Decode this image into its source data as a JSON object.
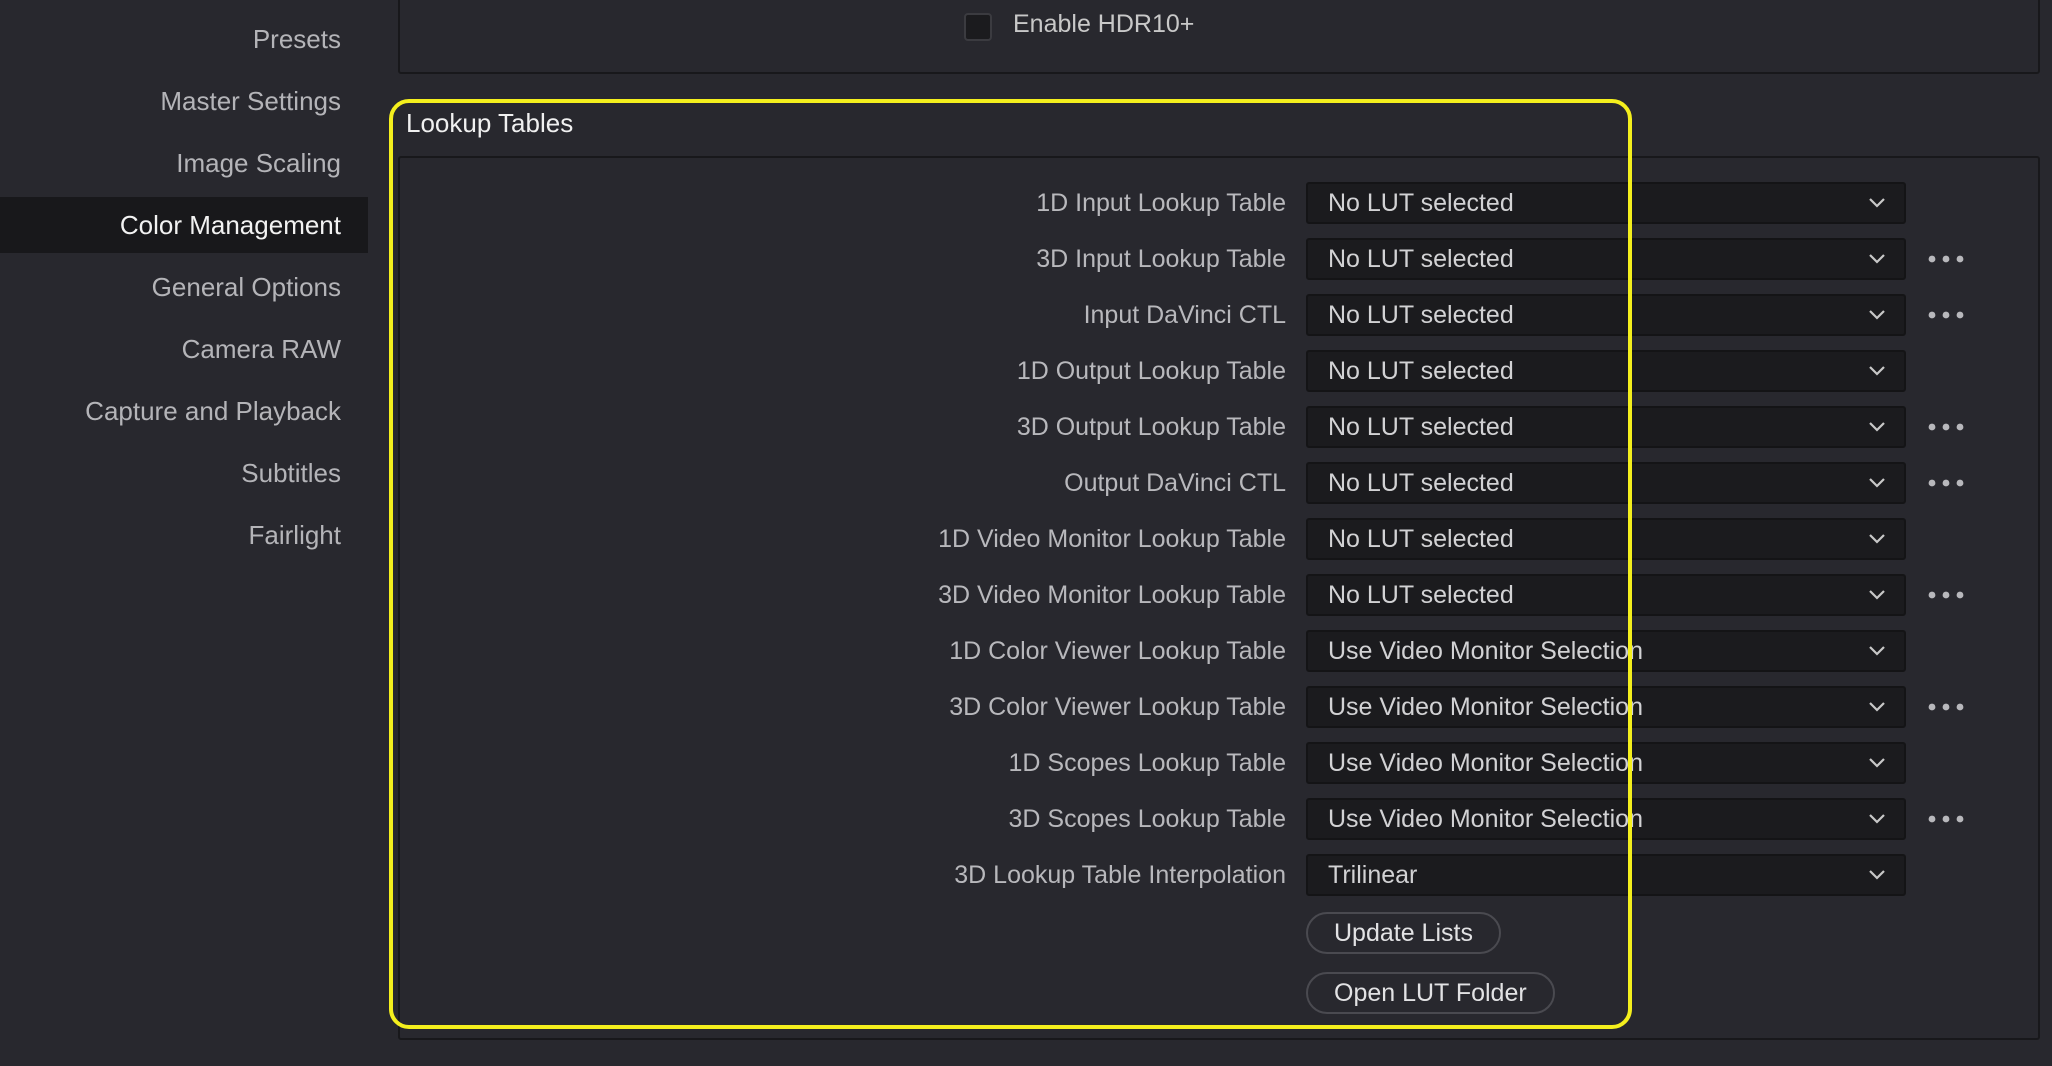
{
  "sidebar": {
    "items": [
      {
        "label": "Presets",
        "active": false
      },
      {
        "label": "Master Settings",
        "active": false
      },
      {
        "label": "Image Scaling",
        "active": false
      },
      {
        "label": "Color Management",
        "active": true
      },
      {
        "label": "General Options",
        "active": false
      },
      {
        "label": "Camera RAW",
        "active": false
      },
      {
        "label": "Capture and Playback",
        "active": false
      },
      {
        "label": "Subtitles",
        "active": false
      },
      {
        "label": "Fairlight",
        "active": false
      }
    ]
  },
  "top_panel": {
    "checkbox_label": "Enable HDR10+",
    "checkbox_checked": false
  },
  "lookup_tables": {
    "title": "Lookup Tables",
    "rows": [
      {
        "label": "1D Input Lookup Table",
        "value": "No LUT selected",
        "has_more": false
      },
      {
        "label": "3D Input Lookup Table",
        "value": "No LUT selected",
        "has_more": true
      },
      {
        "label": "Input DaVinci CTL",
        "value": "No LUT selected",
        "has_more": true
      },
      {
        "label": "1D Output Lookup Table",
        "value": "No LUT selected",
        "has_more": false
      },
      {
        "label": "3D Output Lookup Table",
        "value": "No LUT selected",
        "has_more": true
      },
      {
        "label": "Output DaVinci CTL",
        "value": "No LUT selected",
        "has_more": true
      },
      {
        "label": "1D Video Monitor Lookup Table",
        "value": "No LUT selected",
        "has_more": false
      },
      {
        "label": "3D Video Monitor Lookup Table",
        "value": "No LUT selected",
        "has_more": true
      },
      {
        "label": "1D Color Viewer Lookup Table",
        "value": "Use Video Monitor Selection",
        "has_more": false
      },
      {
        "label": "3D Color Viewer Lookup Table",
        "value": "Use Video Monitor Selection",
        "has_more": true
      },
      {
        "label": "1D Scopes Lookup Table",
        "value": "Use Video Monitor Selection",
        "has_more": false
      },
      {
        "label": "3D Scopes Lookup Table",
        "value": "Use Video Monitor Selection",
        "has_more": true
      },
      {
        "label": "3D Lookup Table Interpolation",
        "value": "Trilinear",
        "has_more": false
      }
    ],
    "update_lists_label": "Update Lists",
    "open_lut_folder_label": "Open LUT Folder"
  },
  "colors": {
    "background": "#28282e",
    "active_sidebar": "#18181b",
    "highlight": "#f4ef1d"
  }
}
